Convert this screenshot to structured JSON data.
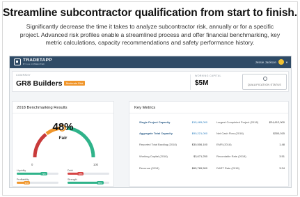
{
  "headline": "Streamline subcontractor qualification from start to finish.",
  "subtext": "Significantly decrease the time it takes to analyze subcontractor risk, annually or for a specific project. Advanced risk profiles enable a streamlined process and offer financial benchmarking, key metric calculations, capacity recommendations and safety performance history.",
  "app": {
    "logo_name": "TRADETAPP",
    "logo_sub": "BY ALL CONNECTED",
    "user_name": "Jessie Jackson",
    "header": {
      "company_label": "COMPANY",
      "company_name": "GR8 Builders",
      "company_badge": "Moderate Risk",
      "working_label": "WORKING CAPITAL",
      "working_value": "$5M",
      "qual_status_label": "QUALIFICATION STATUS"
    },
    "benchmark": {
      "title": "2018 Benchmarking Results",
      "score": "48%",
      "grade": "Fair",
      "score_fraction": 0.48,
      "min": "0",
      "max": "100",
      "metrics": [
        {
          "label": "Liquidity",
          "pill": "72%",
          "fraction": 0.72,
          "color": "#2fb38a"
        },
        {
          "label": "Debt",
          "pill": "38%",
          "fraction": 0.38,
          "color": "#d64545"
        },
        {
          "label": "Profitability",
          "pill": "31%",
          "fraction": 0.31,
          "color": "#f0962b"
        },
        {
          "label": "Strength",
          "pill": "85%",
          "fraction": 0.85,
          "color": "#2fb38a"
        }
      ]
    },
    "key_metrics": {
      "title": "Key Metrics",
      "left": [
        {
          "label": "Single Project Capacity",
          "value": "$15,465,000",
          "highlight": true
        },
        {
          "label": "Aggregate Total Capacity",
          "value": "$90,221,000",
          "highlight": true
        },
        {
          "label": "Reported Total Backlog (2018)",
          "value": "$30,506,100",
          "highlight": false
        },
        {
          "label": "Working Capital (2018)",
          "value": "$3,671,250",
          "highlight": false
        },
        {
          "label": "Revenue (2018)",
          "value": "$65,789,500",
          "highlight": false
        }
      ],
      "right": [
        {
          "label": "Largest Completed Project (2018)",
          "value": "$24,612,000"
        },
        {
          "label": "Net Cash Flow (2018)",
          "value": "$300,015"
        },
        {
          "label": "EMR (2018)",
          "value": "1.48"
        },
        {
          "label": "Recordable Rate (2018)",
          "value": "3.51"
        },
        {
          "label": "DART Rate (2018)",
          "value": "3.24"
        }
      ]
    }
  }
}
